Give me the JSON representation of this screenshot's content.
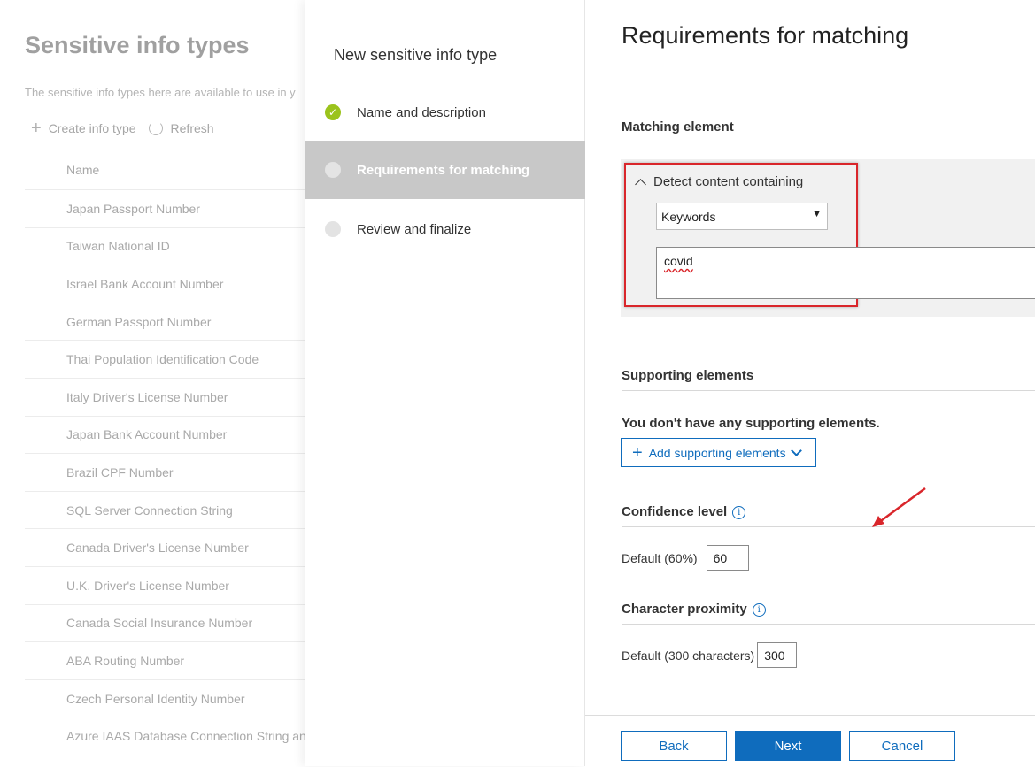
{
  "background_page": {
    "title": "Sensitive info types",
    "description": "The sensitive info types here are available to use in y",
    "toolbar": {
      "create_label": "Create info type",
      "refresh_label": "Refresh"
    },
    "column_header": "Name",
    "rows": [
      "Japan Passport Number",
      "Taiwan National ID",
      "Israel Bank Account Number",
      "German Passport Number",
      "Thai Population Identification Code",
      "Italy Driver's License Number",
      "Japan Bank Account Number",
      "Brazil CPF Number",
      "SQL Server Connection String",
      "Canada Driver's License Number",
      "U.K. Driver's License Number",
      "Canada Social Insurance Number",
      "ABA Routing Number",
      "Czech Personal Identity Number",
      "Azure IAAS Database Connection String an"
    ]
  },
  "wizard": {
    "title": "New sensitive info type",
    "steps": [
      {
        "label": "Name and description",
        "status": "complete"
      },
      {
        "label": "Requirements for matching",
        "status": "active"
      },
      {
        "label": "Review and finalize",
        "status": "pending"
      }
    ]
  },
  "main": {
    "title": "Requirements for matching",
    "matching_element": {
      "heading": "Matching element",
      "detect_label": "Detect content containing",
      "type_select_value": "Keywords",
      "keywords_value": "covid"
    },
    "supporting": {
      "heading": "Supporting elements",
      "empty_text": "You don't have any supporting elements.",
      "add_button_label": "Add supporting elements"
    },
    "confidence": {
      "heading": "Confidence level",
      "default_label": "Default (60%)",
      "value": "60"
    },
    "proximity": {
      "heading": "Character proximity",
      "default_label": "Default (300 characters)",
      "value": "300"
    },
    "footer": {
      "back_label": "Back",
      "next_label": "Next",
      "cancel_label": "Cancel"
    }
  },
  "colors": {
    "accent": "#0f6cbd",
    "success": "#9bc31c",
    "highlight_outline": "#d9262b",
    "active_step_bg": "#c8c8c8"
  }
}
